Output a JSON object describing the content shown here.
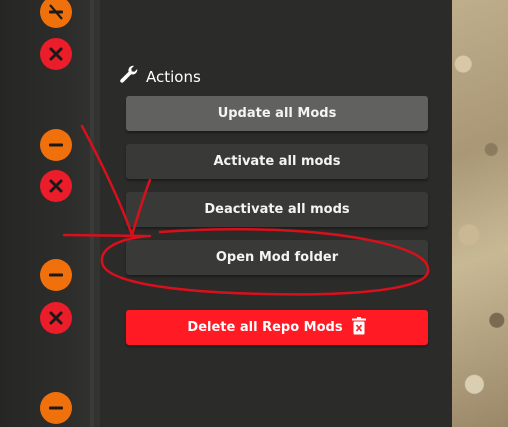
{
  "actions_section": {
    "heading": "Actions",
    "heading_icon": "wrench-icon",
    "buttons": {
      "update_all": "Update all Mods",
      "activate_all": "Activate all mods",
      "deactivate_all": "Deactivate all mods",
      "open_folder": "Open Mod folder",
      "delete_all_repo": "Delete all Repo Mods"
    },
    "delete_icon": "trash-icon"
  },
  "mod_list_icons": [
    "disabled-icon",
    "remove-icon",
    "minus-icon",
    "remove-icon",
    "minus-icon",
    "remove-icon",
    "minus-icon"
  ],
  "colors": {
    "panel_bg": "#2b2b2a",
    "button_bg": "#393938",
    "button_primary_bg": "#616160",
    "danger": "#ff1a24",
    "minus_orange": "#f0710b",
    "remove_red": "#ec1d2a",
    "annotation_red": "#d8101c"
  }
}
